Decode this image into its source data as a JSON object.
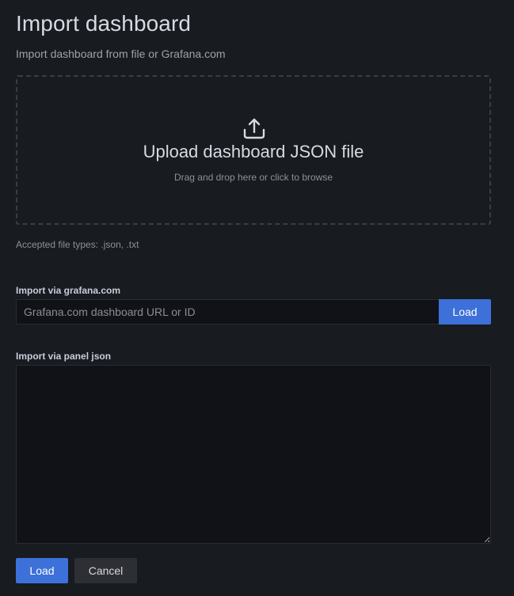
{
  "header": {
    "title": "Import dashboard",
    "subtitle": "Import dashboard from file or Grafana.com"
  },
  "upload": {
    "icon": "upload-icon",
    "title": "Upload dashboard JSON file",
    "hint": "Drag and drop here or click to browse",
    "accepted": "Accepted file types: .json, .txt"
  },
  "grafana_import": {
    "label": "Import via grafana.com",
    "input_value": "",
    "placeholder": "Grafana.com dashboard URL or ID",
    "load_label": "Load"
  },
  "panel_json": {
    "label": "Import via panel json",
    "value": ""
  },
  "actions": {
    "load_label": "Load",
    "cancel_label": "Cancel"
  },
  "colors": {
    "background": "#181b1f",
    "input_background": "#111217",
    "primary": "#3d71d9",
    "secondary": "#2d2f35"
  }
}
